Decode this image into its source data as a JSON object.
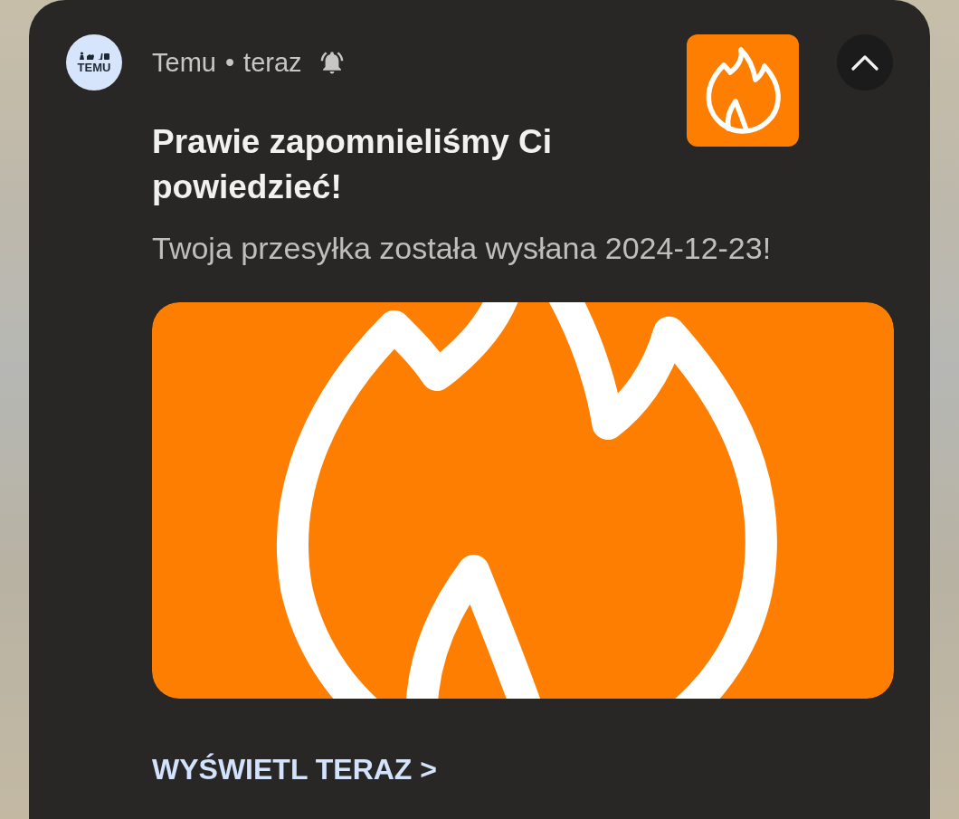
{
  "notification": {
    "app": {
      "logo_text": "TEMU",
      "name": "Temu"
    },
    "separator": "•",
    "time": "teraz",
    "expanded": true,
    "title": "Prawie zapomnieliśmy Ci powiedzieć!",
    "body": "Twoja przesyłka została wysłana 2024-12-23!",
    "action": "WYŚWIETL TERAZ >"
  }
}
